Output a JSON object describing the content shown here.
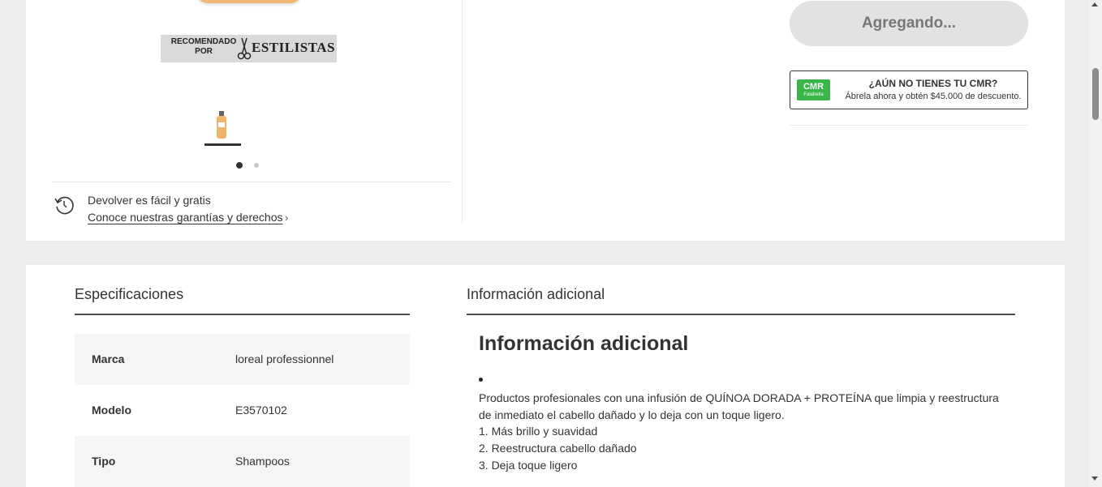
{
  "gallery": {
    "badge_small": "RECOMENDADO\nPOR",
    "badge_big": "ESTILISTAS",
    "thumbnails_count": 1,
    "dots": 2,
    "active_dot": 1
  },
  "returns": {
    "line1": "Devolver es fácil y gratis",
    "line2": "Conoce nuestras garantías y derechos",
    "chevron": "›"
  },
  "purchase": {
    "add_button_label": "Agregando..."
  },
  "cmr": {
    "logo_main": "CMR",
    "logo_sub": "Falabella",
    "title": "¿AÚN NO TIENES TU CMR?",
    "subtitle": "Ábrela ahora y obtén $45.000 de descuento."
  },
  "specs": {
    "title": "Especificaciones",
    "rows": [
      {
        "key": "Marca",
        "value": "loreal professionnel"
      },
      {
        "key": "Modelo",
        "value": "E3570102"
      },
      {
        "key": "Tipo",
        "value": "Shampoos"
      }
    ]
  },
  "info": {
    "tab_title": "Información adicional",
    "heading": "Información adicional",
    "paragraph": "Productos profesionales con una infusión de QUÍNOA DORADA + PROTEÍNA que limpia y reestructura de inmediato el cabello dañado y lo deja con un toque ligero.",
    "items": [
      "1. Más brillo y suavidad",
      "2. Reestructura cabello dañado",
      "3. Deja toque ligero"
    ]
  },
  "colors": {
    "cmr_green": "#3ab54a",
    "product_orange": "#f2b873",
    "button_disabled": "#e2e2e2"
  }
}
